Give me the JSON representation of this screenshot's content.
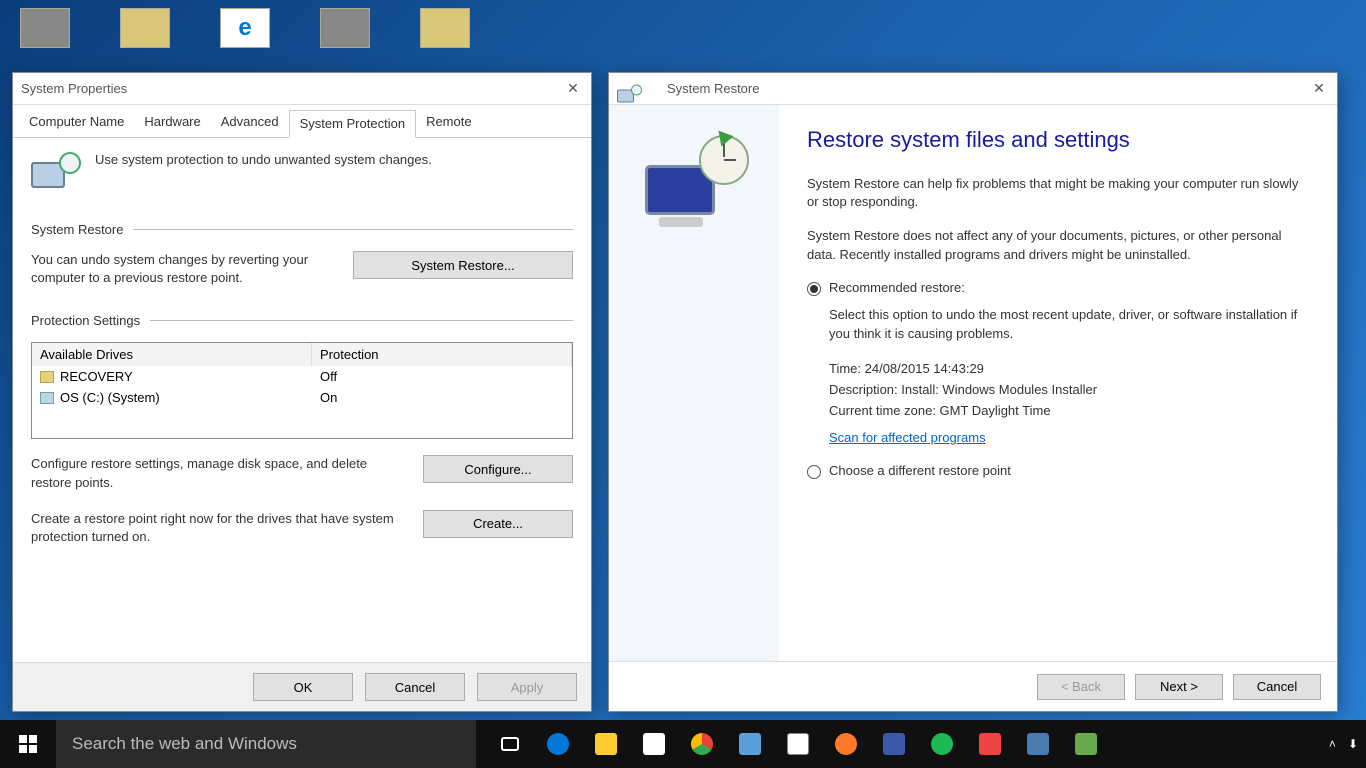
{
  "desktop": {},
  "sysprops": {
    "title": "System Properties",
    "tabs": [
      "Computer Name",
      "Hardware",
      "Advanced",
      "System Protection",
      "Remote"
    ],
    "active_tab": "System Protection",
    "intro": "Use system protection to undo unwanted system changes.",
    "sr_group": "System Restore",
    "sr_text": "You can undo system changes by reverting your computer to a previous restore point.",
    "sr_button": "System Restore...",
    "ps_group": "Protection Settings",
    "col_drives": "Available Drives",
    "col_protection": "Protection",
    "drives": [
      {
        "name": "RECOVERY",
        "protection": "Off"
      },
      {
        "name": "OS (C:) (System)",
        "protection": "On"
      }
    ],
    "configure_text": "Configure restore settings, manage disk space, and delete restore points.",
    "configure_btn": "Configure...",
    "create_text": "Create a restore point right now for the drives that have system protection turned on.",
    "create_btn": "Create...",
    "ok": "OK",
    "cancel": "Cancel",
    "apply": "Apply"
  },
  "restore": {
    "title": "System Restore",
    "heading": "Restore system files and settings",
    "p1": "System Restore can help fix problems that might be making your computer run slowly or stop responding.",
    "p2": "System Restore does not affect any of your documents, pictures, or other personal data. Recently installed programs and drivers might be uninstalled.",
    "opt1_label": "Recommended restore:",
    "opt1_desc": "Select this option to undo the most recent update, driver, or software installation if you think it is causing problems.",
    "time": "Time: 24/08/2015 14:43:29",
    "desc": "Description: Install: Windows Modules Installer",
    "tz": "Current time zone: GMT Daylight Time",
    "scan_link": "Scan for affected programs",
    "opt2_label": "Choose a different restore point",
    "back": "< Back",
    "next": "Next >",
    "cancel": "Cancel"
  },
  "taskbar": {
    "search_placeholder": "Search the web and Windows"
  }
}
